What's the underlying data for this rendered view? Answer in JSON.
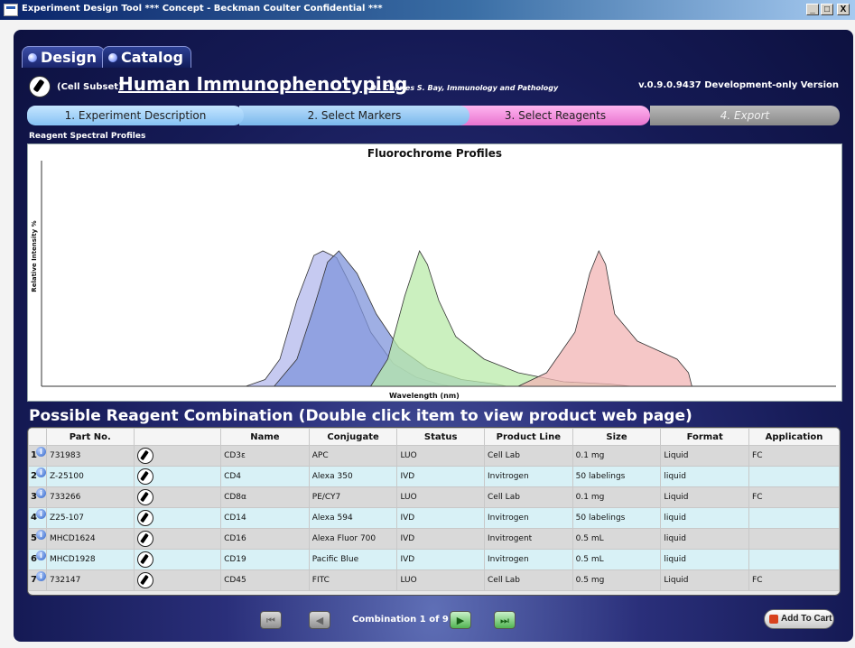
{
  "window": {
    "title": "Experiment Design Tool  *** Concept - Beckman Coulter Confidential ***",
    "buttons": {
      "minimize": "_",
      "maximize": "□",
      "close": "X"
    }
  },
  "tabs": [
    {
      "label": "Design",
      "active": true
    },
    {
      "label": "Catalog",
      "active": false
    }
  ],
  "header": {
    "subset": "(Cell Subset)",
    "title": "Human Immunophenotyping",
    "author": "Dr. Charles S. Bay, Immunology and Pathology",
    "version": "v.0.9.0.9437 Development-only Version"
  },
  "steps": [
    {
      "label": "1. Experiment Description"
    },
    {
      "label": "2. Select Markers"
    },
    {
      "label": "3. Select Reagents",
      "active": true
    },
    {
      "label": "4. Export",
      "disabled": true
    }
  ],
  "spectral_section_label": "Reagent Spectral Profiles",
  "chart_data": {
    "type": "area",
    "title": "Fluorochrome Profiles",
    "xlabel": "Wavelength (nm)",
    "ylabel": "Relative Intensity %",
    "xlim": [
      300,
      1000
    ],
    "ylim": [
      0,
      100
    ],
    "grid": false,
    "series": [
      {
        "color": "#b3b8ec",
        "x": [
          480,
          497,
          510,
          525,
          540,
          548,
          560,
          575,
          590,
          610,
          630,
          650,
          660
        ],
        "y": [
          0,
          3,
          12,
          38,
          58,
          60,
          57,
          42,
          24,
          10,
          4,
          1,
          0
        ]
      },
      {
        "color": "#7f94db",
        "x": [
          505,
          525,
          540,
          552,
          562,
          578,
          595,
          615,
          640,
          670,
          700,
          710
        ],
        "y": [
          0,
          12,
          35,
          55,
          60,
          50,
          32,
          17,
          8,
          3,
          1,
          0
        ]
      },
      {
        "color": "#b9eba9",
        "x": [
          590,
          605,
          620,
          633,
          640,
          650,
          665,
          690,
          720,
          760,
          800,
          820
        ],
        "y": [
          0,
          12,
          40,
          60,
          54,
          38,
          22,
          12,
          6,
          2,
          1,
          0
        ]
      },
      {
        "color": "#f1b4b4",
        "x": [
          720,
          745,
          770,
          783,
          791,
          797,
          805,
          825,
          860,
          870,
          873
        ],
        "y": [
          0,
          6,
          24,
          50,
          60,
          54,
          32,
          20,
          12,
          6,
          0
        ]
      }
    ]
  },
  "table_section_label": "Possible Reagent Combination (Double click item to view product web page)",
  "table": {
    "columns": [
      "",
      "Part No.",
      "",
      "Name",
      "Conjugate",
      "Status",
      "Product Line",
      "Size",
      "Format",
      "Application"
    ],
    "rows": [
      {
        "num": "1",
        "part": "731983",
        "name": "CD3ε",
        "conjugate": "APC",
        "status": "LUO",
        "line": "Cell Lab",
        "size": "0.1 mg",
        "format": "Liquid",
        "app": "FC"
      },
      {
        "num": "2",
        "part": "Z-25100",
        "name": "CD4",
        "conjugate": "Alexa 350",
        "status": "IVD",
        "line": "Invitrogen",
        "size": "50 labelings",
        "format": "liquid",
        "app": ""
      },
      {
        "num": "3",
        "part": "733266",
        "name": "CD8α",
        "conjugate": "PE/CY7",
        "status": "LUO",
        "line": "Cell Lab",
        "size": "0.1 mg",
        "format": "Liquid",
        "app": "FC"
      },
      {
        "num": "4",
        "part": "Z25-107",
        "name": "CD14",
        "conjugate": "Alexa 594",
        "status": "IVD",
        "line": "Invitrogen",
        "size": "50 labelings",
        "format": "liquid",
        "app": ""
      },
      {
        "num": "5",
        "part": "MHCD1624",
        "name": "CD16",
        "conjugate": "Alexa Fluor 700",
        "status": "IVD",
        "line": "Invitrogent",
        "size": "0.5 mL",
        "format": "liquid",
        "app": ""
      },
      {
        "num": "6",
        "part": "MHCD1928",
        "name": "CD19",
        "conjugate": "Pacific Blue",
        "status": "IVD",
        "line": "Invitrogen",
        "size": "0.5 mL",
        "format": "liquid",
        "app": ""
      },
      {
        "num": "7",
        "part": "732147",
        "name": "CD45",
        "conjugate": "FITC",
        "status": "LUO",
        "line": "Cell Lab",
        "size": "0.5 mg",
        "format": "Liquid",
        "app": "FC"
      }
    ]
  },
  "nav": {
    "combination": "Combination 1 of 9",
    "add_to_cart": "Add To Cart",
    "icons": [
      "first-icon",
      "prev-icon",
      "next-icon",
      "last-icon"
    ]
  }
}
